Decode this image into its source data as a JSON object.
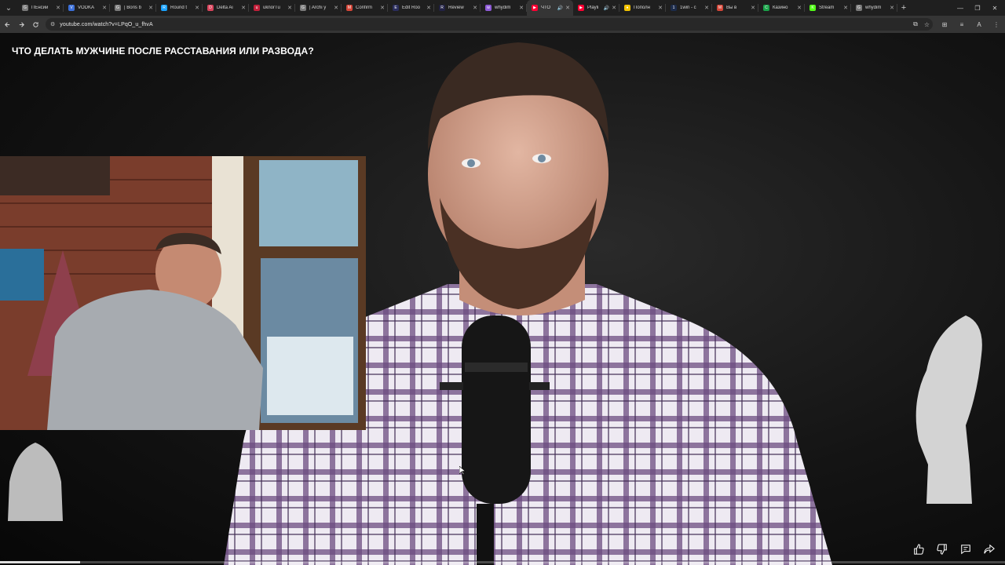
{
  "browser": {
    "tabs": [
      {
        "label": "ПЕнсии",
        "color": "#7a7a7a",
        "glyph": "G"
      },
      {
        "label": "VODKA",
        "color": "#3b6fd9",
        "glyph": "V"
      },
      {
        "label": "| Boris b",
        "color": "#7a7a7a",
        "glyph": "G"
      },
      {
        "label": "Round t",
        "color": "#1aa3ff",
        "glyph": "R"
      },
      {
        "label": "Delta Ai",
        "color": "#d9435b",
        "glyph": "D"
      },
      {
        "label": "uknorTu",
        "color": "#c21f3a",
        "glyph": "u"
      },
      {
        "label": "| Archi y",
        "color": "#7a7a7a",
        "glyph": "G"
      },
      {
        "label": "Confirm",
        "color": "#d44638",
        "glyph": "M"
      },
      {
        "label": "Edit Roo",
        "color": "#2a2d5c",
        "glyph": "E"
      },
      {
        "label": "Review",
        "color": "#222244",
        "glyph": "R"
      },
      {
        "label": "whydim",
        "color": "#8e5bd6",
        "glyph": "w"
      },
      {
        "label": "ЧТО",
        "color": "#ff0033",
        "glyph": "▶",
        "active": true,
        "audio": true
      },
      {
        "label": "Playli",
        "color": "#ff0033",
        "glyph": "▶",
        "audio": true
      },
      {
        "label": "Пополн",
        "color": "#f2c200",
        "glyph": "●"
      },
      {
        "label": "1win - c",
        "color": "#1c2b4a",
        "glyph": "1"
      },
      {
        "label": "Вы в",
        "color": "#d44638",
        "glyph": "M"
      },
      {
        "label": "Казино",
        "color": "#1aa34a",
        "glyph": "C"
      },
      {
        "label": "Stream",
        "color": "#53fc18",
        "glyph": "K"
      },
      {
        "label": "whydim",
        "color": "#7a7a7a",
        "glyph": "G"
      }
    ],
    "new_tab_label": "+",
    "window_controls": {
      "minimize": "—",
      "restore": "❐",
      "close": "✕"
    },
    "url": "youtube.com/watch?v=LPqO_u_fhvA"
  },
  "video": {
    "title": "ЧТО ДЕЛАТЬ МУЖЧИНЕ ПОСЛЕ РАССТАВАНИЯ ИЛИ РАЗВОДА?",
    "progress": 0.08,
    "controls": [
      "like-icon",
      "dislike-icon",
      "comment-icon",
      "share-icon"
    ]
  }
}
